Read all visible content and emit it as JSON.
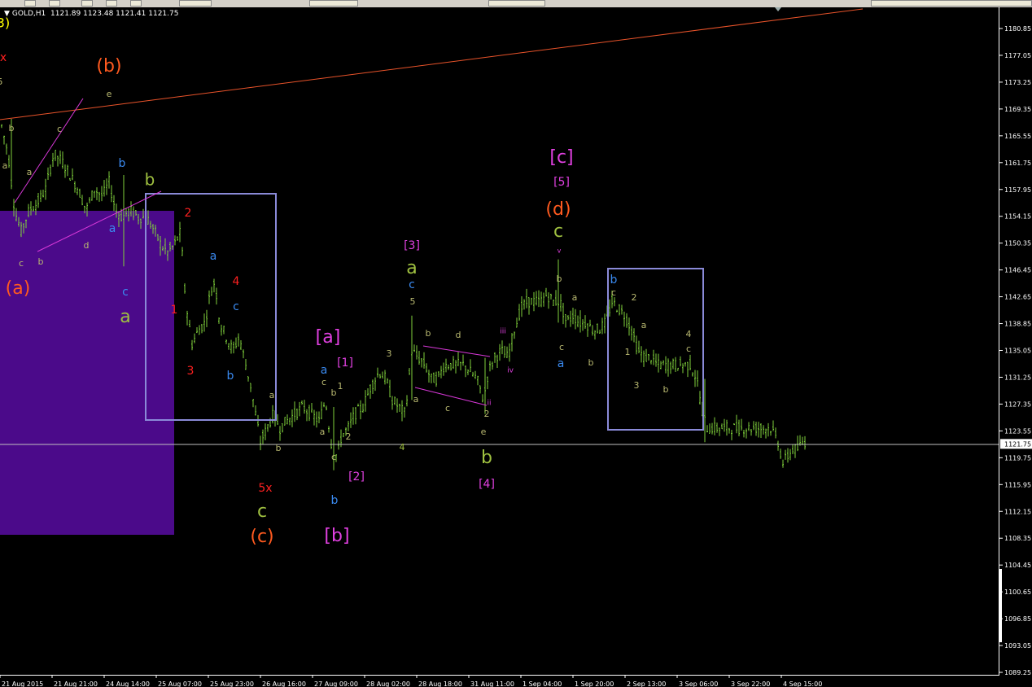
{
  "window": {
    "symbol": "GOLD,H1",
    "ohlc": "1121.89 1123.48 1121.41 1121.75",
    "current_price": "1121.75"
  },
  "colors": {
    "background": "#000000",
    "candles": "#7fd13b",
    "bid_line": "#c0c0c0",
    "trend_line": "#e8532a",
    "boxes": "#8a8ad8",
    "purple_zone": "#4b0a8a",
    "channel": "#d838d8"
  },
  "y_axis": [
    "1180.85",
    "1177.05",
    "1173.25",
    "1169.35",
    "1165.55",
    "1161.75",
    "1157.95",
    "1154.15",
    "1150.35",
    "1146.45",
    "1142.65",
    "1138.85",
    "1135.05",
    "1131.25",
    "1127.35",
    "1123.55",
    "1119.75",
    "1115.95",
    "1112.15",
    "1108.35",
    "1104.45",
    "1100.65",
    "1096.85",
    "1093.05",
    "1089.25"
  ],
  "x_axis": [
    "21 Aug 2015",
    "21 Aug 21:00",
    "24 Aug 14:00",
    "25 Aug 07:00",
    "25 Aug 23:00",
    "26 Aug 16:00",
    "27 Aug 09:00",
    "28 Aug 02:00",
    "28 Aug 18:00",
    "31 Aug 11:00",
    "1 Sep 04:00",
    "1 Sep 20:00",
    "2 Sep 13:00",
    "3 Sep 06:00",
    "3 Sep 22:00",
    "4 Sep 15:00"
  ],
  "wave_labels": [
    {
      "text": "3)",
      "color": "#ffff00"
    },
    {
      "text": "x",
      "color": "#ff2020"
    },
    {
      "text": "5",
      "color": "#b8b870"
    },
    {
      "text": "(b)",
      "color": "#ff5a1f"
    },
    {
      "text": "e",
      "color": "#b8b870"
    },
    {
      "text": "b",
      "color": "#b8b870"
    },
    {
      "text": "c",
      "color": "#b8b870"
    },
    {
      "text": "a",
      "color": "#b8b870"
    },
    {
      "text": "a",
      "color": "#b8b870"
    },
    {
      "text": "c",
      "color": "#b8b870"
    },
    {
      "text": "b",
      "color": "#b8b870"
    },
    {
      "text": "d",
      "color": "#b8b870"
    },
    {
      "text": "(a)",
      "color": "#ff5a1f"
    },
    {
      "text": "b",
      "color": "#3a8af0"
    },
    {
      "text": "a",
      "color": "#3a8af0"
    },
    {
      "text": "c",
      "color": "#3a8af0"
    },
    {
      "text": "a",
      "color": "#9fc040"
    },
    {
      "text": "b",
      "color": "#9fc040"
    },
    {
      "text": "2",
      "color": "#ff2020"
    },
    {
      "text": "1",
      "color": "#ff2020"
    },
    {
      "text": "3",
      "color": "#ff2020"
    },
    {
      "text": "a",
      "color": "#3a8af0"
    },
    {
      "text": "4",
      "color": "#ff2020"
    },
    {
      "text": "c",
      "color": "#3a8af0"
    },
    {
      "text": "b",
      "color": "#3a8af0"
    },
    {
      "text": "a",
      "color": "#b8b870"
    },
    {
      "text": "b",
      "color": "#b8b870"
    },
    {
      "text": "5x",
      "color": "#ff2020"
    },
    {
      "text": "c",
      "color": "#9fc040"
    },
    {
      "text": "(c)",
      "color": "#ff5a1f"
    },
    {
      "text": "[a]",
      "color": "#e040e0"
    },
    {
      "text": "a",
      "color": "#3a8af0"
    },
    {
      "text": "c",
      "color": "#b8b870"
    },
    {
      "text": "[1]",
      "color": "#e040e0"
    },
    {
      "text": "1",
      "color": "#b8b870"
    },
    {
      "text": "b",
      "color": "#b8b870"
    },
    {
      "text": "a",
      "color": "#b8b870"
    },
    {
      "text": "2",
      "color": "#b8b870"
    },
    {
      "text": "c",
      "color": "#b8b870"
    },
    {
      "text": "b",
      "color": "#3a8af0"
    },
    {
      "text": "[2]",
      "color": "#e040e0"
    },
    {
      "text": "[b]",
      "color": "#e040e0"
    },
    {
      "text": "3",
      "color": "#b8b870"
    },
    {
      "text": "4",
      "color": "#9fc040"
    },
    {
      "text": "[3]",
      "color": "#e040e0"
    },
    {
      "text": "a",
      "color": "#9fc040"
    },
    {
      "text": "c",
      "color": "#3a8af0"
    },
    {
      "text": "5",
      "color": "#b8b870"
    },
    {
      "text": "b",
      "color": "#b8b870"
    },
    {
      "text": "d",
      "color": "#b8b870"
    },
    {
      "text": "a",
      "color": "#b8b870"
    },
    {
      "text": "c",
      "color": "#b8b870"
    },
    {
      "text": "e",
      "color": "#b8b870"
    },
    {
      "text": "2",
      "color": "#b8b870"
    },
    {
      "text": "iii",
      "color": "#e040e0"
    },
    {
      "text": "iv",
      "color": "#e040e0"
    },
    {
      "text": "ii",
      "color": "#e040e0"
    },
    {
      "text": "b",
      "color": "#9fc040"
    },
    {
      "text": "[4]",
      "color": "#e040e0"
    },
    {
      "text": "[c]",
      "color": "#e040e0"
    },
    {
      "text": "[5]",
      "color": "#e040e0"
    },
    {
      "text": "(d)",
      "color": "#ff5a1f"
    },
    {
      "text": "c",
      "color": "#9fc040"
    },
    {
      "text": "v",
      "color": "#e040e0"
    },
    {
      "text": "b",
      "color": "#b8b870"
    },
    {
      "text": "a",
      "color": "#b8b870"
    },
    {
      "text": "c",
      "color": "#b8b870"
    },
    {
      "text": "a",
      "color": "#3a8af0"
    },
    {
      "text": "b",
      "color": "#b8b870"
    },
    {
      "text": "b",
      "color": "#3a8af0"
    },
    {
      "text": "c",
      "color": "#b8b870"
    },
    {
      "text": "2",
      "color": "#b8b870"
    },
    {
      "text": "a",
      "color": "#b8b870"
    },
    {
      "text": "1",
      "color": "#b8b870"
    },
    {
      "text": "3",
      "color": "#b8b870"
    },
    {
      "text": "b",
      "color": "#b8b870"
    },
    {
      "text": "4",
      "color": "#b8b870"
    },
    {
      "text": "c",
      "color": "#b8b870"
    }
  ]
}
